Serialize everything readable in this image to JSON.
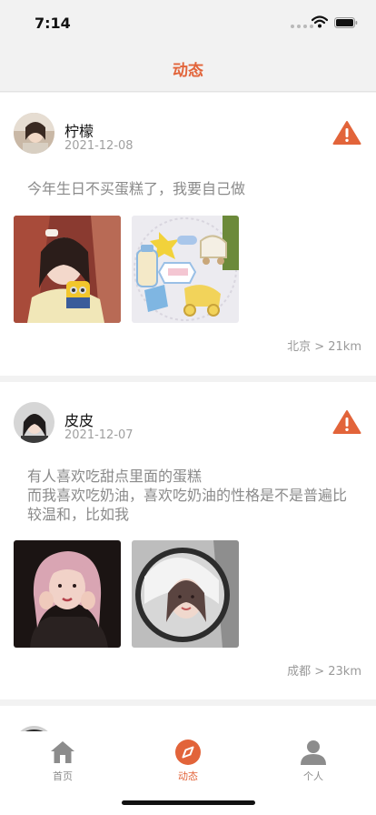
{
  "status_bar": {
    "time": "7:14"
  },
  "nav": {
    "title": "动态"
  },
  "posts": [
    {
      "username": "柠檬",
      "date": "2021-12-08",
      "text": "今年生日不买蛋糕了，我要自己做",
      "location": "北京 > 21km",
      "images": [
        "selfie-with-minion-cup",
        "baby-shower-decorated-cookies"
      ]
    },
    {
      "username": "皮皮",
      "date": "2021-12-07",
      "text": "有人喜欢吃甜点里面的蛋糕\n而我喜欢吃奶油，喜欢吃奶油的性格是不是普遍比较温和，比如我",
      "location": "成都 > 23km",
      "images": [
        "pink-hair-girl-portrait",
        "girl-round-mirror-portrait"
      ]
    }
  ],
  "tabs": [
    {
      "label": "首页",
      "icon": "home-icon",
      "active": false
    },
    {
      "label": "动态",
      "icon": "compass-icon",
      "active": true
    },
    {
      "label": "个人",
      "icon": "person-icon",
      "active": false
    }
  ],
  "colors": {
    "accent": "#e2643a",
    "inactive": "#8c8c8c",
    "text_muted": "#8a8a8a"
  }
}
